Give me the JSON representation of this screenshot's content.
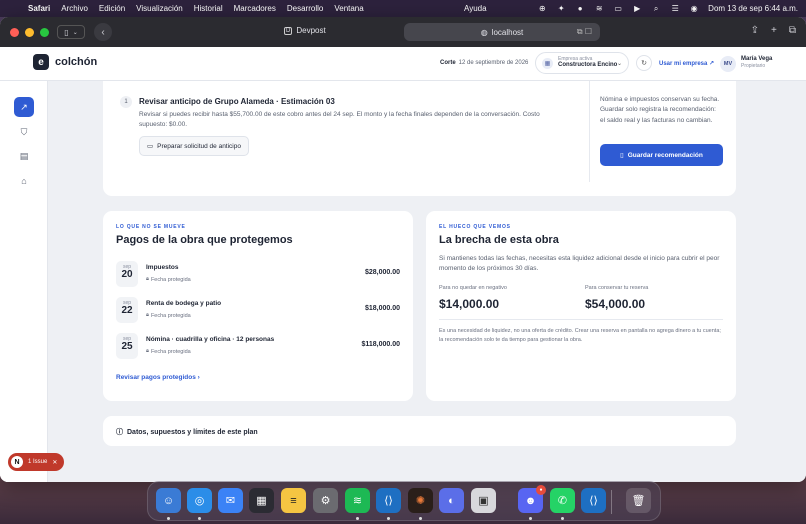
{
  "menubar": {
    "app": "Safari",
    "items": [
      "Archivo",
      "Edición",
      "Visualización",
      "Historial",
      "Marcadores",
      "Desarrollo",
      "Ventana"
    ],
    "help": "Ayuda",
    "clock": "Dom 13 de sep  6:44 a.m."
  },
  "browser": {
    "tab_title": "Devpost",
    "url": "localhost"
  },
  "header": {
    "logo_letter": "e",
    "brand": "colchón",
    "corte_label": "Corte",
    "corte_date": "12 de septiembre de 2026",
    "empresa_label": "Empresa activa",
    "empresa_value": "Constructora Encino",
    "usar_link": "Usar mi empresa ↗",
    "avatar_initials": "MV",
    "user_name": "María Vega",
    "user_role": "Propietario"
  },
  "recommendation": {
    "step_number": "1",
    "title": "Revisar anticipo de Grupo Alameda · Estimación 03",
    "description": "Revisar si puedes recibir hasta $55,700.00 de este cobro antes del 24 sep. El monto y la fecha finales dependen de la conversación. Costo supuesto: $0.00.",
    "prep_button": "Preparar solicitud de anticipo",
    "side_text": "Nómina e impuestos conservan su fecha. Guardar solo registra la recomendación: el saldo real y las facturas no cambian.",
    "save_button": "Guardar recomendación"
  },
  "pagos": {
    "eyebrow": "LO QUE NO SE MUEVE",
    "title": "Pagos de la obra que protegemos",
    "rows": [
      {
        "month": "sep",
        "day": "20",
        "name": "Impuestos",
        "tag": "Fecha protegida",
        "amount": "$28,000.00"
      },
      {
        "month": "sep",
        "day": "22",
        "name": "Renta de bodega y patio",
        "tag": "Fecha protegida",
        "amount": "$18,000.00"
      },
      {
        "month": "sep",
        "day": "25",
        "name": "Nómina · cuadrilla y oficina · 12 personas",
        "tag": "Fecha protegida",
        "amount": "$118,000.00"
      }
    ],
    "link": "Revisar pagos protegidos ›"
  },
  "brecha": {
    "eyebrow": "EL HUECO QUE VEMOS",
    "title": "La brecha de esta obra",
    "description": "Si mantienes todas las fechas, necesitas esta liquidez adicional desde el inicio para cubrir el peor momento de los próximos 30 días.",
    "metric1_label": "Para no quedar en negativo",
    "metric1_value": "$14,000.00",
    "metric2_label": "Para conservar tu reserva",
    "metric2_value": "$54,000.00",
    "note": "Es una necesidad de liquidez, no una oferta de crédito. Crear una reserva en pantalla no agrega dinero a tu cuenta; la recomendación solo te da tiempo para gestionar la obra."
  },
  "datos": {
    "label": "Datos, supuestos y límites de este plan"
  },
  "issue": {
    "letter": "N",
    "label": "1 Issue"
  },
  "colors": {
    "accent": "#2f5bd3",
    "dark": "#1e2433",
    "issue": "#c0392b"
  }
}
